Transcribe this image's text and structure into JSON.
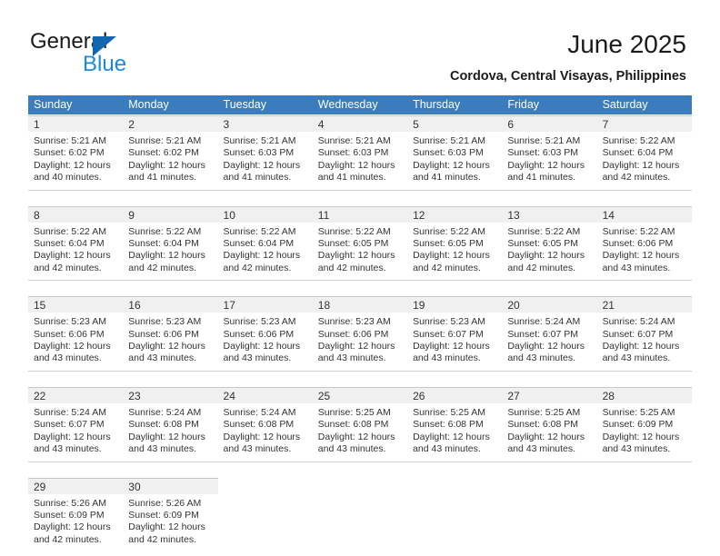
{
  "brand": {
    "name_part1": "General",
    "name_part2": "Blue",
    "triangle_color": "#1166b0",
    "blue_color": "#1b8ade"
  },
  "header": {
    "title": "June 2025",
    "subtitle": "Cordova, Central Visayas, Philippines",
    "header_bg": "#3a7cbe"
  },
  "weekdays": [
    "Sunday",
    "Monday",
    "Tuesday",
    "Wednesday",
    "Thursday",
    "Friday",
    "Saturday"
  ],
  "weeks": [
    [
      {
        "day": "1",
        "sunrise": "Sunrise: 5:21 AM",
        "sunset": "Sunset: 6:02 PM",
        "daylight1": "Daylight: 12 hours",
        "daylight2": "and 40 minutes."
      },
      {
        "day": "2",
        "sunrise": "Sunrise: 5:21 AM",
        "sunset": "Sunset: 6:02 PM",
        "daylight1": "Daylight: 12 hours",
        "daylight2": "and 41 minutes."
      },
      {
        "day": "3",
        "sunrise": "Sunrise: 5:21 AM",
        "sunset": "Sunset: 6:03 PM",
        "daylight1": "Daylight: 12 hours",
        "daylight2": "and 41 minutes."
      },
      {
        "day": "4",
        "sunrise": "Sunrise: 5:21 AM",
        "sunset": "Sunset: 6:03 PM",
        "daylight1": "Daylight: 12 hours",
        "daylight2": "and 41 minutes."
      },
      {
        "day": "5",
        "sunrise": "Sunrise: 5:21 AM",
        "sunset": "Sunset: 6:03 PM",
        "daylight1": "Daylight: 12 hours",
        "daylight2": "and 41 minutes."
      },
      {
        "day": "6",
        "sunrise": "Sunrise: 5:21 AM",
        "sunset": "Sunset: 6:03 PM",
        "daylight1": "Daylight: 12 hours",
        "daylight2": "and 41 minutes."
      },
      {
        "day": "7",
        "sunrise": "Sunrise: 5:22 AM",
        "sunset": "Sunset: 6:04 PM",
        "daylight1": "Daylight: 12 hours",
        "daylight2": "and 42 minutes."
      }
    ],
    [
      {
        "day": "8",
        "sunrise": "Sunrise: 5:22 AM",
        "sunset": "Sunset: 6:04 PM",
        "daylight1": "Daylight: 12 hours",
        "daylight2": "and 42 minutes."
      },
      {
        "day": "9",
        "sunrise": "Sunrise: 5:22 AM",
        "sunset": "Sunset: 6:04 PM",
        "daylight1": "Daylight: 12 hours",
        "daylight2": "and 42 minutes."
      },
      {
        "day": "10",
        "sunrise": "Sunrise: 5:22 AM",
        "sunset": "Sunset: 6:04 PM",
        "daylight1": "Daylight: 12 hours",
        "daylight2": "and 42 minutes."
      },
      {
        "day": "11",
        "sunrise": "Sunrise: 5:22 AM",
        "sunset": "Sunset: 6:05 PM",
        "daylight1": "Daylight: 12 hours",
        "daylight2": "and 42 minutes."
      },
      {
        "day": "12",
        "sunrise": "Sunrise: 5:22 AM",
        "sunset": "Sunset: 6:05 PM",
        "daylight1": "Daylight: 12 hours",
        "daylight2": "and 42 minutes."
      },
      {
        "day": "13",
        "sunrise": "Sunrise: 5:22 AM",
        "sunset": "Sunset: 6:05 PM",
        "daylight1": "Daylight: 12 hours",
        "daylight2": "and 42 minutes."
      },
      {
        "day": "14",
        "sunrise": "Sunrise: 5:22 AM",
        "sunset": "Sunset: 6:06 PM",
        "daylight1": "Daylight: 12 hours",
        "daylight2": "and 43 minutes."
      }
    ],
    [
      {
        "day": "15",
        "sunrise": "Sunrise: 5:23 AM",
        "sunset": "Sunset: 6:06 PM",
        "daylight1": "Daylight: 12 hours",
        "daylight2": "and 43 minutes."
      },
      {
        "day": "16",
        "sunrise": "Sunrise: 5:23 AM",
        "sunset": "Sunset: 6:06 PM",
        "daylight1": "Daylight: 12 hours",
        "daylight2": "and 43 minutes."
      },
      {
        "day": "17",
        "sunrise": "Sunrise: 5:23 AM",
        "sunset": "Sunset: 6:06 PM",
        "daylight1": "Daylight: 12 hours",
        "daylight2": "and 43 minutes."
      },
      {
        "day": "18",
        "sunrise": "Sunrise: 5:23 AM",
        "sunset": "Sunset: 6:06 PM",
        "daylight1": "Daylight: 12 hours",
        "daylight2": "and 43 minutes."
      },
      {
        "day": "19",
        "sunrise": "Sunrise: 5:23 AM",
        "sunset": "Sunset: 6:07 PM",
        "daylight1": "Daylight: 12 hours",
        "daylight2": "and 43 minutes."
      },
      {
        "day": "20",
        "sunrise": "Sunrise: 5:24 AM",
        "sunset": "Sunset: 6:07 PM",
        "daylight1": "Daylight: 12 hours",
        "daylight2": "and 43 minutes."
      },
      {
        "day": "21",
        "sunrise": "Sunrise: 5:24 AM",
        "sunset": "Sunset: 6:07 PM",
        "daylight1": "Daylight: 12 hours",
        "daylight2": "and 43 minutes."
      }
    ],
    [
      {
        "day": "22",
        "sunrise": "Sunrise: 5:24 AM",
        "sunset": "Sunset: 6:07 PM",
        "daylight1": "Daylight: 12 hours",
        "daylight2": "and 43 minutes."
      },
      {
        "day": "23",
        "sunrise": "Sunrise: 5:24 AM",
        "sunset": "Sunset: 6:08 PM",
        "daylight1": "Daylight: 12 hours",
        "daylight2": "and 43 minutes."
      },
      {
        "day": "24",
        "sunrise": "Sunrise: 5:24 AM",
        "sunset": "Sunset: 6:08 PM",
        "daylight1": "Daylight: 12 hours",
        "daylight2": "and 43 minutes."
      },
      {
        "day": "25",
        "sunrise": "Sunrise: 5:25 AM",
        "sunset": "Sunset: 6:08 PM",
        "daylight1": "Daylight: 12 hours",
        "daylight2": "and 43 minutes."
      },
      {
        "day": "26",
        "sunrise": "Sunrise: 5:25 AM",
        "sunset": "Sunset: 6:08 PM",
        "daylight1": "Daylight: 12 hours",
        "daylight2": "and 43 minutes."
      },
      {
        "day": "27",
        "sunrise": "Sunrise: 5:25 AM",
        "sunset": "Sunset: 6:08 PM",
        "daylight1": "Daylight: 12 hours",
        "daylight2": "and 43 minutes."
      },
      {
        "day": "28",
        "sunrise": "Sunrise: 5:25 AM",
        "sunset": "Sunset: 6:09 PM",
        "daylight1": "Daylight: 12 hours",
        "daylight2": "and 43 minutes."
      }
    ],
    [
      {
        "day": "29",
        "sunrise": "Sunrise: 5:26 AM",
        "sunset": "Sunset: 6:09 PM",
        "daylight1": "Daylight: 12 hours",
        "daylight2": "and 42 minutes."
      },
      {
        "day": "30",
        "sunrise": "Sunrise: 5:26 AM",
        "sunset": "Sunset: 6:09 PM",
        "daylight1": "Daylight: 12 hours",
        "daylight2": "and 42 minutes."
      },
      {
        "day": "",
        "sunrise": "",
        "sunset": "",
        "daylight1": "",
        "daylight2": ""
      },
      {
        "day": "",
        "sunrise": "",
        "sunset": "",
        "daylight1": "",
        "daylight2": ""
      },
      {
        "day": "",
        "sunrise": "",
        "sunset": "",
        "daylight1": "",
        "daylight2": ""
      },
      {
        "day": "",
        "sunrise": "",
        "sunset": "",
        "daylight1": "",
        "daylight2": ""
      },
      {
        "day": "",
        "sunrise": "",
        "sunset": "",
        "daylight1": "",
        "daylight2": ""
      }
    ]
  ]
}
